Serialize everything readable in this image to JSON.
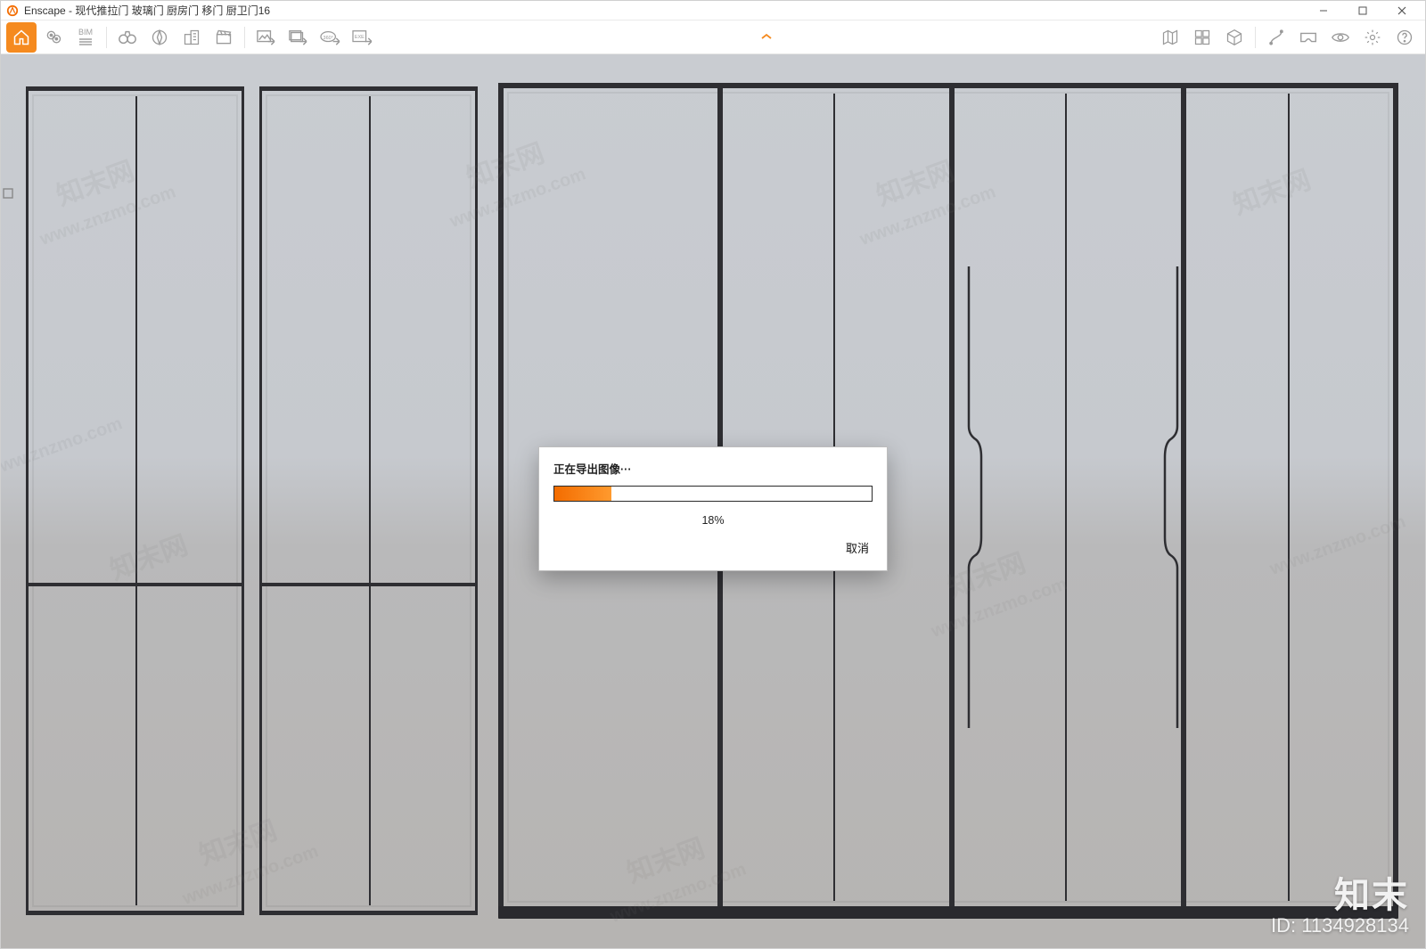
{
  "window": {
    "app_name": "Enscape",
    "title_sep": " - ",
    "document_title": "现代推拉门 玻璃门 厨房门 移门 厨卫门16"
  },
  "win_controls": {
    "min": "—",
    "max": "▢",
    "close": "✕"
  },
  "toolbar": {
    "home": "home-icon",
    "location": "map-pin-icon",
    "bim_label": "BIM",
    "binoculars": "binoculars-icon",
    "compass": "compass-icon",
    "building": "building-icon",
    "clapper": "clapperboard-icon",
    "export_img": "export-image-icon",
    "export_batch": "export-batch-icon",
    "export_360": "export-360-icon",
    "export_exe": "export-exe-icon",
    "right": {
      "map": "site-map-icon",
      "library": "asset-library-icon",
      "cube": "cube-icon",
      "separator": "|",
      "path": "path-icon",
      "vr": "vr-headset-icon",
      "eye": "eye-icon",
      "settings": "gear-icon",
      "help": "help-icon"
    }
  },
  "modal": {
    "title": "正在导出图像···",
    "percent_label": "18%",
    "percent_value": 18,
    "cancel": "取消"
  },
  "watermark": {
    "cn": "知末网",
    "url": "www.znzmo.com"
  },
  "brand": {
    "cn": "知末",
    "id_label": "ID: 1134928134"
  },
  "colors": {
    "accent": "#f58a1f",
    "frame": "#2e2e32"
  }
}
